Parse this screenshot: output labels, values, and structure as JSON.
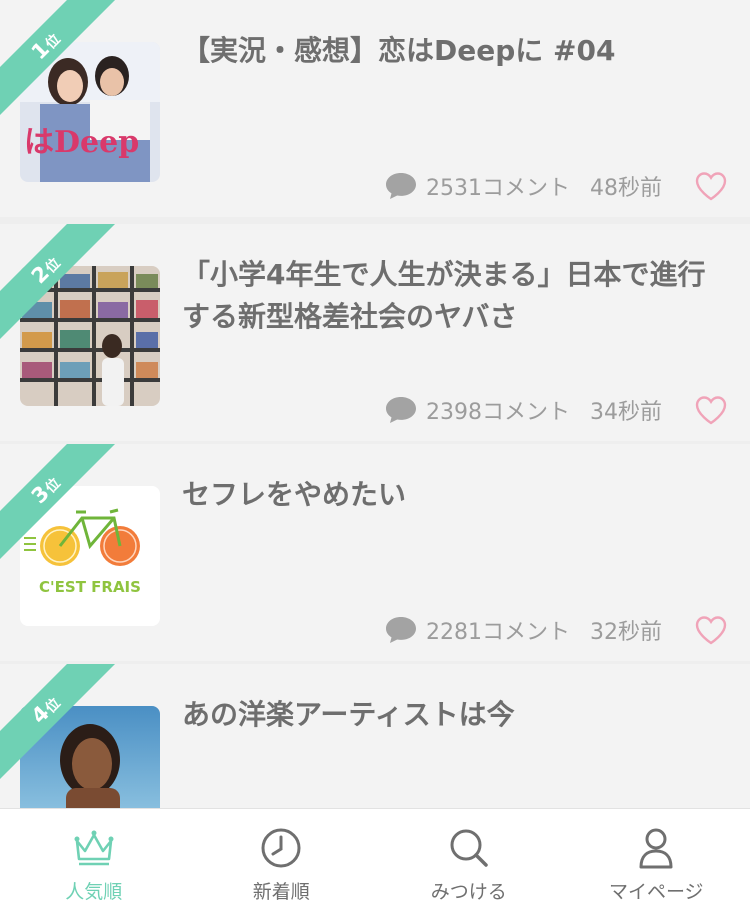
{
  "articles": [
    {
      "rank_num": "1",
      "rank_suffix": "位",
      "title": "【実況・感想】恋はDeepに #04",
      "comments": "2531コメント",
      "time": "48秒前",
      "thumb": "drama-poster",
      "thumb_text": "はDeep"
    },
    {
      "rank_num": "2",
      "rank_suffix": "位",
      "title": "「小学4年生で人生が決まる」日本で進行する新型格差社会のヤバさ",
      "comments": "2398コメント",
      "time": "34秒前",
      "thumb": "bookshelf-photo"
    },
    {
      "rank_num": "3",
      "rank_suffix": "位",
      "title": "セフレをやめたい",
      "comments": "2281コメント",
      "time": "32秒前",
      "thumb": "cest-frais-logo",
      "thumb_text": "C'EST FRAIS"
    },
    {
      "rank_num": "4",
      "rank_suffix": "位",
      "title": "あの洋楽アーティストは今",
      "thumb": "artist-photo"
    }
  ],
  "tabs": [
    {
      "label": "人気順",
      "icon": "crown-icon",
      "active": true
    },
    {
      "label": "新着順",
      "icon": "clock-icon",
      "active": false
    },
    {
      "label": "みつける",
      "icon": "search-icon",
      "active": false
    },
    {
      "label": "マイページ",
      "icon": "person-icon",
      "active": false
    }
  ],
  "colors": {
    "accent": "#6fd1b4",
    "heart": "#f0a3b8",
    "text": "#6e6e6e",
    "meta": "#9c9c9c"
  }
}
